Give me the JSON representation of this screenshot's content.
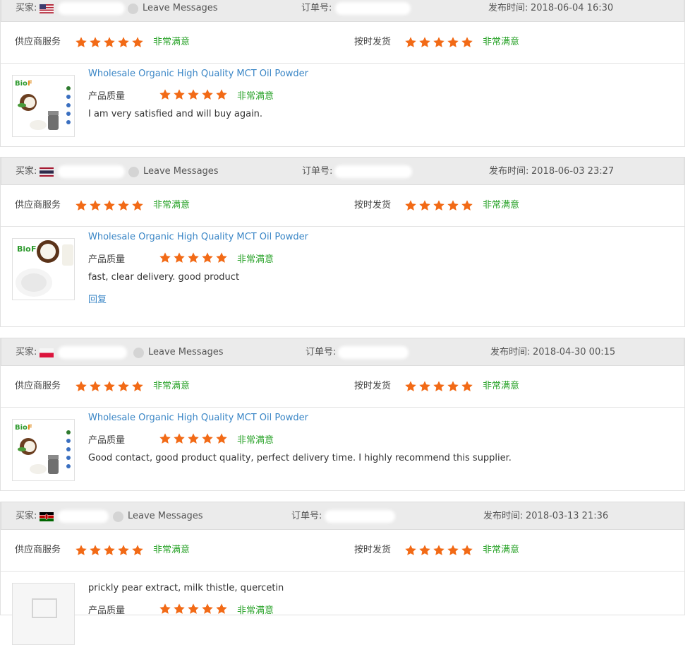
{
  "labels": {
    "buyer": "买家:",
    "order_no": "订单号:",
    "posted_time": "发布时间:",
    "supplier_service": "供应商服务",
    "on_time_shipping": "按时发货",
    "product_quality": "产品质量",
    "very_satisfied": "非常满意",
    "leave_messages": "Leave Messages",
    "reply": "回复"
  },
  "reviews": [
    {
      "country": "US",
      "posted": "2018-06-04 16:30",
      "product_title": "Wholesale Organic High Quality MCT Oil Powder",
      "comment": "I am very satisfied and will buy again.",
      "supplier_rating": 5,
      "shipping_rating": 5,
      "quality_rating": 5
    },
    {
      "country": "TH",
      "posted": "2018-06-03 23:27",
      "product_title": "Wholesale Organic High Quality MCT Oil Powder",
      "comment": "fast, clear delivery. good product",
      "supplier_rating": 5,
      "shipping_rating": 5,
      "quality_rating": 5
    },
    {
      "country": "PL",
      "posted": "2018-04-30 00:15",
      "product_title": "Wholesale Organic High Quality MCT Oil Powder",
      "comment": "Good contact, good product quality, perfect delivery time. I highly recommend this supplier.",
      "supplier_rating": 5,
      "shipping_rating": 5,
      "quality_rating": 5
    },
    {
      "country": "KE",
      "posted": "2018-03-13 21:36",
      "product_title": "prickly pear extract, milk thistle, quercetin",
      "supplier_rating": 5,
      "shipping_rating": 5,
      "quality_rating": 5
    }
  ],
  "colors": {
    "star": "#f26a16",
    "satisfied": "#2aa32a",
    "link": "#3a86c6",
    "header_bg": "#ebebeb"
  }
}
